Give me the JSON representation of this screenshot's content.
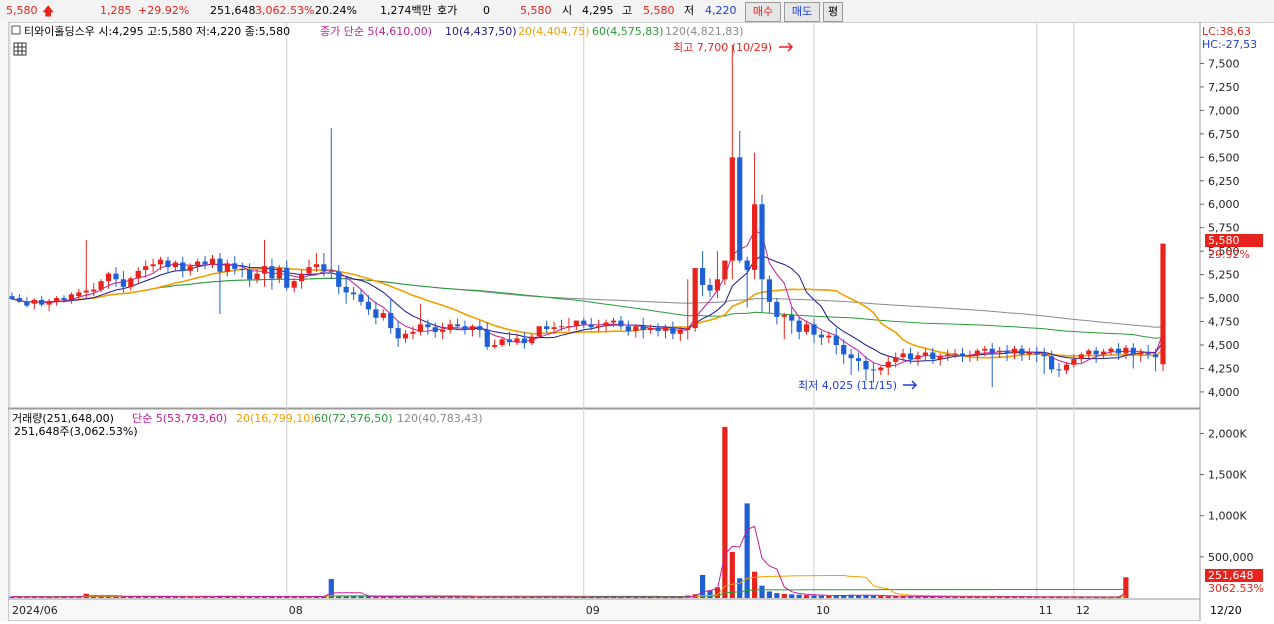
{
  "topbar": {
    "price": "5,580",
    "change": "1,285",
    "change_pct": "+29.92%",
    "volume": "251,648",
    "vol_ratio": "3,062.53%",
    "turnover": "20.24%",
    "amount": "1,274백만",
    "hoga_label": "호가",
    "hoga_value": "0",
    "hoga_price": "5,580",
    "open_label": "시",
    "open": "4,295",
    "high_label": "고",
    "high": "5,580",
    "low_label": "저",
    "low": "4,220",
    "buy_label": "매수",
    "sell_label": "매도",
    "eval_label": "평"
  },
  "price_pane": {
    "title": "티와이홀딩스우 시:4,295 고:5,580 저:4,220 종:5,580",
    "legend_close": "종가 단순 5(4,610,00)",
    "legend_ma10": "10(4,437,50)",
    "legend_ma20": "20(4,404,75)",
    "legend_ma60": "60(4,575,83)",
    "legend_ma120": "120(4,821,83)",
    "lc_label": "LC:38,63",
    "hc_label": "HC:-27,53",
    "high_marker": "최고 7,700 (10/29)",
    "low_marker": "최저 4,025 (11/15)",
    "last_price_tag": "5,580",
    "last_pct_tag": "29.92%",
    "yaxis_ticks": [
      "7,500",
      "7,250",
      "7,000",
      "6,750",
      "6,500",
      "6,250",
      "6,000",
      "5,750",
      "5,500",
      "5,250",
      "5,000",
      "4,750",
      "4,500",
      "4,250",
      "4,000"
    ]
  },
  "volume_pane": {
    "legend_volume": "거래량(251,648,00)",
    "legend_simple5": "단순 5(53,793,60)",
    "legend_ma20": "20(16,799,10)",
    "legend_ma60": "60(72,576,50)",
    "legend_ma120": "120(40,783,43)",
    "sub_label": "251,648주(3,062.53%)",
    "yaxis_ticks": [
      "2,000K",
      "1,500K",
      "1,000K",
      "500,000"
    ],
    "last_volume_tag": "251,648",
    "last_pct_tag": "3062.53%"
  },
  "xaxis": {
    "labels": [
      "2024/06",
      "08",
      "09",
      "10",
      "11",
      "12"
    ],
    "end_label": "12/20"
  },
  "colors": {
    "up": "#e8231e",
    "down": "#1f5fd6",
    "ma5": "#c0209a",
    "ma10": "#1a1a8a",
    "ma20": "#f0a000",
    "ma60": "#2a9a3a",
    "ma120": "#8a8a8a"
  },
  "chart_data": {
    "type": "candlestick",
    "yrange_price": [
      3850,
      7750
    ],
    "yrange_volume": [
      0,
      2200000
    ],
    "candles": [
      [
        5020,
        5060,
        4990,
        4980
      ],
      [
        5000,
        5040,
        4960,
        4950
      ],
      [
        4960,
        5010,
        4920,
        4900
      ],
      [
        4940,
        5000,
        4980,
        4880
      ],
      [
        4980,
        5020,
        4930,
        4910
      ],
      [
        4930,
        4990,
        4970,
        4860
      ],
      [
        4960,
        5020,
        5000,
        4920
      ],
      [
        5000,
        5030,
        4980,
        4950
      ],
      [
        4980,
        5060,
        5040,
        4940
      ],
      [
        5020,
        5100,
        5060,
        4980
      ],
      [
        5060,
        5620,
        5080,
        5000
      ],
      [
        5070,
        5160,
        5090,
        5020
      ],
      [
        5090,
        5200,
        5180,
        5060
      ],
      [
        5180,
        5280,
        5260,
        5100
      ],
      [
        5260,
        5330,
        5200,
        5120
      ],
      [
        5200,
        5290,
        5120,
        5060
      ],
      [
        5120,
        5230,
        5210,
        5080
      ],
      [
        5210,
        5330,
        5290,
        5160
      ],
      [
        5300,
        5400,
        5340,
        5220
      ],
      [
        5340,
        5420,
        5360,
        5280
      ],
      [
        5360,
        5440,
        5410,
        5300
      ],
      [
        5400,
        5440,
        5330,
        5260
      ],
      [
        5330,
        5400,
        5380,
        5290
      ],
      [
        5380,
        5440,
        5290,
        5220
      ],
      [
        5290,
        5370,
        5340,
        5240
      ],
      [
        5340,
        5420,
        5390,
        5280
      ],
      [
        5390,
        5450,
        5360,
        5310
      ],
      [
        5360,
        5460,
        5420,
        5320
      ],
      [
        5420,
        5480,
        5280,
        4830
      ],
      [
        5280,
        5410,
        5370,
        5230
      ],
      [
        5370,
        5450,
        5310,
        5250
      ],
      [
        5310,
        5380,
        5300,
        5220
      ],
      [
        5300,
        5370,
        5200,
        5120
      ],
      [
        5200,
        5300,
        5260,
        5160
      ],
      [
        5260,
        5620,
        5340,
        5120
      ],
      [
        5340,
        5420,
        5210,
        5090
      ],
      [
        5210,
        5350,
        5320,
        5160
      ],
      [
        5320,
        5400,
        5110,
        5080
      ],
      [
        5110,
        5210,
        5180,
        5060
      ],
      [
        5180,
        5300,
        5260,
        5100
      ],
      [
        5260,
        5410,
        5330,
        5240
      ],
      [
        5330,
        5480,
        5360,
        5280
      ],
      [
        5360,
        5480,
        5290,
        5230
      ],
      [
        5290,
        6810,
        5280,
        5200
      ],
      [
        5280,
        5350,
        5120,
        5040
      ],
      [
        5120,
        5220,
        5060,
        4940
      ],
      [
        5060,
        5120,
        5040,
        4980
      ],
      [
        5040,
        5100,
        4960,
        4920
      ],
      [
        4960,
        5030,
        4880,
        4820
      ],
      [
        4880,
        4960,
        4790,
        4720
      ],
      [
        4790,
        4880,
        4840,
        4760
      ],
      [
        4840,
        5000,
        4680,
        4620
      ],
      [
        4680,
        4760,
        4570,
        4480
      ],
      [
        4570,
        4660,
        4620,
        4520
      ],
      [
        4620,
        4700,
        4640,
        4560
      ],
      [
        4640,
        4940,
        4720,
        4600
      ],
      [
        4720,
        4770,
        4690,
        4610
      ],
      [
        4690,
        4740,
        4640,
        4580
      ],
      [
        4640,
        4740,
        4660,
        4560
      ],
      [
        4660,
        4770,
        4720,
        4620
      ],
      [
        4720,
        4780,
        4700,
        4660
      ],
      [
        4700,
        4760,
        4660,
        4610
      ],
      [
        4660,
        4720,
        4700,
        4590
      ],
      [
        4700,
        4760,
        4660,
        4580
      ],
      [
        4660,
        4740,
        4480,
        4450
      ],
      [
        4480,
        4560,
        4500,
        4460
      ],
      [
        4500,
        4580,
        4560,
        4480
      ],
      [
        4560,
        4640,
        4530,
        4490
      ],
      [
        4530,
        4620,
        4570,
        4500
      ],
      [
        4570,
        4640,
        4520,
        4460
      ],
      [
        4520,
        4620,
        4590,
        4500
      ],
      [
        4590,
        4680,
        4700,
        4570
      ],
      [
        4700,
        4760,
        4670,
        4630
      ],
      [
        4670,
        4750,
        4690,
        4620
      ],
      [
        4690,
        4770,
        4700,
        4650
      ],
      [
        4700,
        4790,
        4700,
        4650
      ],
      [
        4700,
        4760,
        4760,
        4660
      ],
      [
        4760,
        4790,
        4720,
        4680
      ],
      [
        4720,
        4790,
        4690,
        4660
      ],
      [
        4690,
        4770,
        4700,
        4640
      ],
      [
        4700,
        4770,
        4740,
        4640
      ],
      [
        4740,
        4790,
        4760,
        4690
      ],
      [
        4760,
        4810,
        4700,
        4660
      ],
      [
        4700,
        4760,
        4650,
        4600
      ],
      [
        4650,
        4720,
        4700,
        4580
      ],
      [
        4700,
        4790,
        4660,
        4570
      ],
      [
        4660,
        4720,
        4680,
        4620
      ],
      [
        4680,
        4730,
        4650,
        4590
      ],
      [
        4650,
        4720,
        4690,
        4570
      ],
      [
        4690,
        4750,
        4620,
        4560
      ],
      [
        4620,
        4690,
        4660,
        4540
      ],
      [
        4660,
        5200,
        4680,
        4560
      ],
      [
        4680,
        5080,
        5320,
        4640
      ],
      [
        5320,
        5500,
        5140,
        5020
      ],
      [
        5140,
        5210,
        5080,
        5010
      ],
      [
        5080,
        5500,
        5200,
        5000
      ],
      [
        5200,
        5360,
        5400,
        5140
      ],
      [
        5400,
        7700,
        6500,
        5200
      ],
      [
        6500,
        6780,
        5400,
        5370
      ],
      [
        5400,
        5440,
        5300,
        4900
      ],
      [
        5300,
        6550,
        6000,
        5200
      ],
      [
        6000,
        6100,
        5200,
        4850
      ],
      [
        5200,
        5240,
        4960,
        4840
      ],
      [
        4960,
        5000,
        4800,
        4720
      ],
      [
        4800,
        4840,
        4820,
        4560
      ],
      [
        4820,
        4900,
        4760,
        4620
      ],
      [
        4760,
        4800,
        4640,
        4560
      ],
      [
        4640,
        4760,
        4720,
        4610
      ],
      [
        4720,
        4780,
        4610,
        4520
      ],
      [
        4610,
        4650,
        4580,
        4500
      ],
      [
        4580,
        4640,
        4600,
        4520
      ],
      [
        4600,
        4680,
        4500,
        4400
      ],
      [
        4500,
        4560,
        4400,
        4300
      ],
      [
        4400,
        4460,
        4360,
        4180
      ],
      [
        4360,
        4420,
        4330,
        4220
      ],
      [
        4330,
        4380,
        4240,
        4120
      ],
      [
        4240,
        4320,
        4230,
        4100
      ],
      [
        4230,
        4280,
        4260,
        4180
      ],
      [
        4260,
        4390,
        4320,
        4180
      ],
      [
        4320,
        4420,
        4370,
        4260
      ],
      [
        4370,
        4460,
        4410,
        4330
      ],
      [
        4410,
        4470,
        4350,
        4300
      ],
      [
        4350,
        4430,
        4390,
        4280
      ],
      [
        4390,
        4460,
        4420,
        4330
      ],
      [
        4420,
        4470,
        4350,
        4300
      ],
      [
        4350,
        4410,
        4380,
        4280
      ],
      [
        4380,
        4450,
        4400,
        4330
      ],
      [
        4400,
        4460,
        4410,
        4360
      ],
      [
        4410,
        4470,
        4380,
        4320
      ],
      [
        4380,
        4440,
        4390,
        4320
      ],
      [
        4390,
        4460,
        4440,
        4330
      ],
      [
        4440,
        4490,
        4460,
        4380
      ],
      [
        4460,
        4520,
        4420,
        4050
      ],
      [
        4420,
        4480,
        4440,
        4360
      ],
      [
        4440,
        4500,
        4410,
        4330
      ],
      [
        4410,
        4490,
        4460,
        4350
      ],
      [
        4460,
        4500,
        4400,
        4330
      ],
      [
        4400,
        4470,
        4420,
        4340
      ],
      [
        4420,
        4480,
        4400,
        4320
      ],
      [
        4400,
        4470,
        4380,
        4190
      ],
      [
        4380,
        4440,
        4240,
        4200
      ],
      [
        4240,
        4310,
        4230,
        4160
      ],
      [
        4230,
        4320,
        4290,
        4190
      ],
      [
        4290,
        4400,
        4350,
        4260
      ],
      [
        4350,
        4420,
        4400,
        4310
      ],
      [
        4400,
        4460,
        4440,
        4360
      ],
      [
        4440,
        4480,
        4400,
        4310
      ],
      [
        4400,
        4460,
        4430,
        4360
      ],
      [
        4430,
        4480,
        4460,
        4390
      ],
      [
        4460,
        4520,
        4410,
        4340
      ],
      [
        4410,
        4500,
        4470,
        4350
      ],
      [
        4470,
        4520,
        4400,
        4250
      ],
      [
        4400,
        4460,
        4420,
        4320
      ],
      [
        4420,
        4500,
        4400,
        4350
      ],
      [
        4400,
        4460,
        4370,
        4220
      ],
      [
        4295,
        5580,
        5580,
        4220
      ]
    ],
    "volumes": [
      18000,
      14000,
      12000,
      16000,
      13000,
      11000,
      15000,
      17000,
      22000,
      19000,
      52000,
      26000,
      23000,
      21000,
      18000,
      17000,
      20000,
      22000,
      19000,
      17000,
      18000,
      16000,
      15000,
      17000,
      16000,
      18000,
      17000,
      16000,
      24000,
      20000,
      18000,
      17000,
      16000,
      18000,
      21000,
      17000,
      16000,
      18000,
      15000,
      17000,
      19000,
      20000,
      18000,
      230000,
      32000,
      24000,
      20000,
      18000,
      19000,
      17000,
      16000,
      18000,
      17000,
      15000,
      14000,
      19000,
      15000,
      14000,
      13000,
      14000,
      14000,
      13000,
      12000,
      13000,
      16000,
      13000,
      12000,
      13000,
      12000,
      13000,
      12000,
      14000,
      13000,
      12000,
      13000,
      12000,
      12000,
      11000,
      12000,
      11000,
      12000,
      12000,
      11000,
      12000,
      11000,
      12000,
      11000,
      12000,
      11000,
      12000,
      11000,
      30000,
      45000,
      280000,
      90000,
      130000,
      2080000,
      560000,
      240000,
      1150000,
      320000,
      150000,
      80000,
      60000,
      50000,
      45000,
      40000,
      35000,
      30000,
      28000,
      26000,
      30000,
      35000,
      40000,
      36000,
      30000,
      28000,
      24000,
      22000,
      20000,
      20000,
      19000,
      18000,
      17000,
      17000,
      16000,
      16000,
      15000,
      15000,
      14000,
      15000,
      20000,
      16000,
      15000,
      14000,
      14000,
      13000,
      14000,
      13000,
      12000,
      13000,
      12000,
      12000,
      12000,
      11000,
      12000,
      11000,
      11000,
      11000,
      12000,
      251648
    ]
  }
}
